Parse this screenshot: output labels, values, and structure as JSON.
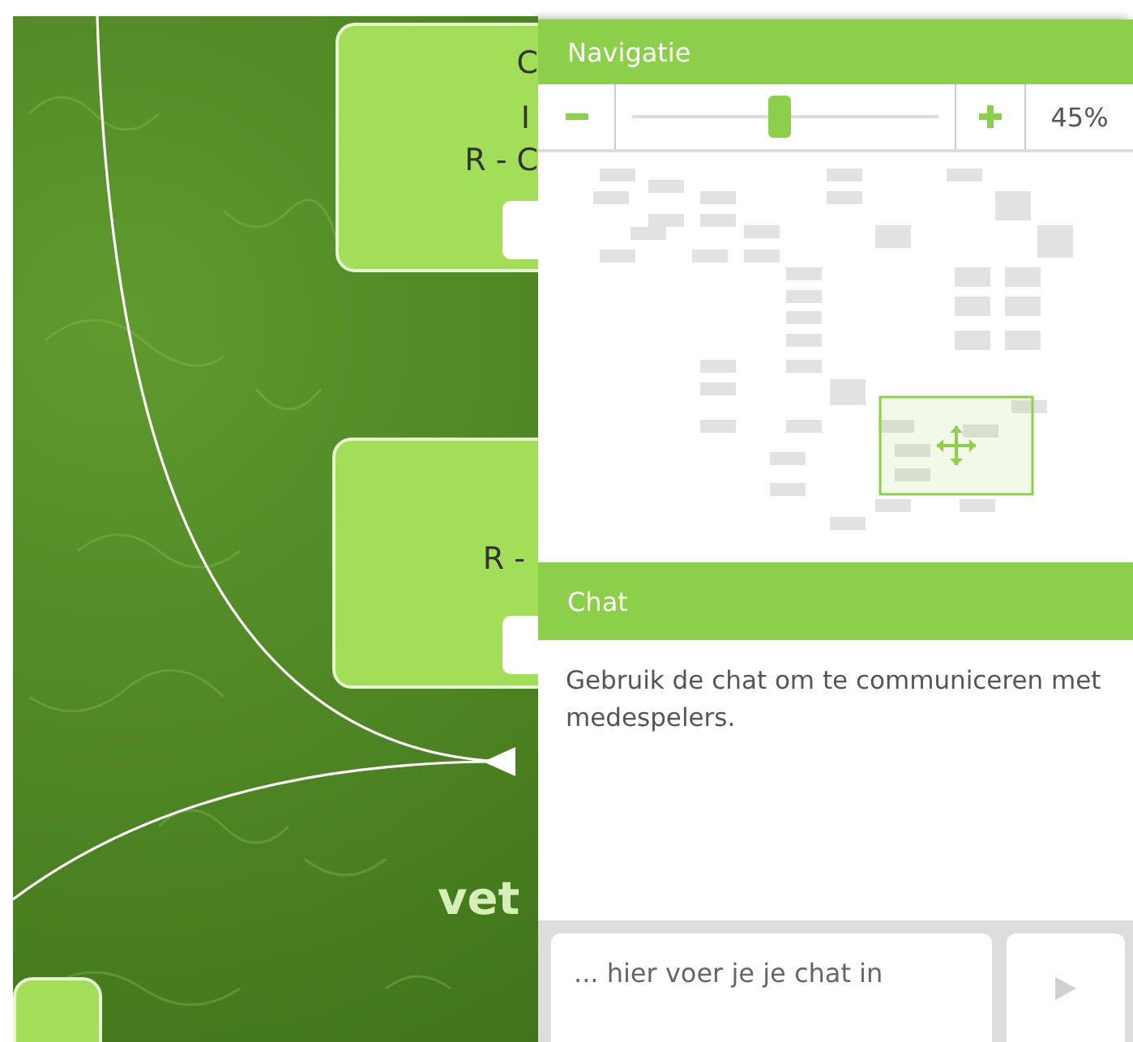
{
  "canvas": {
    "nodes": [
      {
        "kind": "card",
        "lines": [
          "C",
          "I",
          "R - C"
        ]
      },
      {
        "kind": "card",
        "lines": [
          "R -"
        ]
      },
      {
        "kind": "card"
      }
    ],
    "label": "vet"
  },
  "navigation": {
    "title": "Navigatie",
    "zoom": {
      "level": 0.48,
      "percent": "45%"
    }
  },
  "chat": {
    "title": "Chat",
    "message": "Gebruik de chat om te communiceren met medespelers.",
    "input": {
      "placeholder": "... hier voer je je chat in"
    }
  }
}
